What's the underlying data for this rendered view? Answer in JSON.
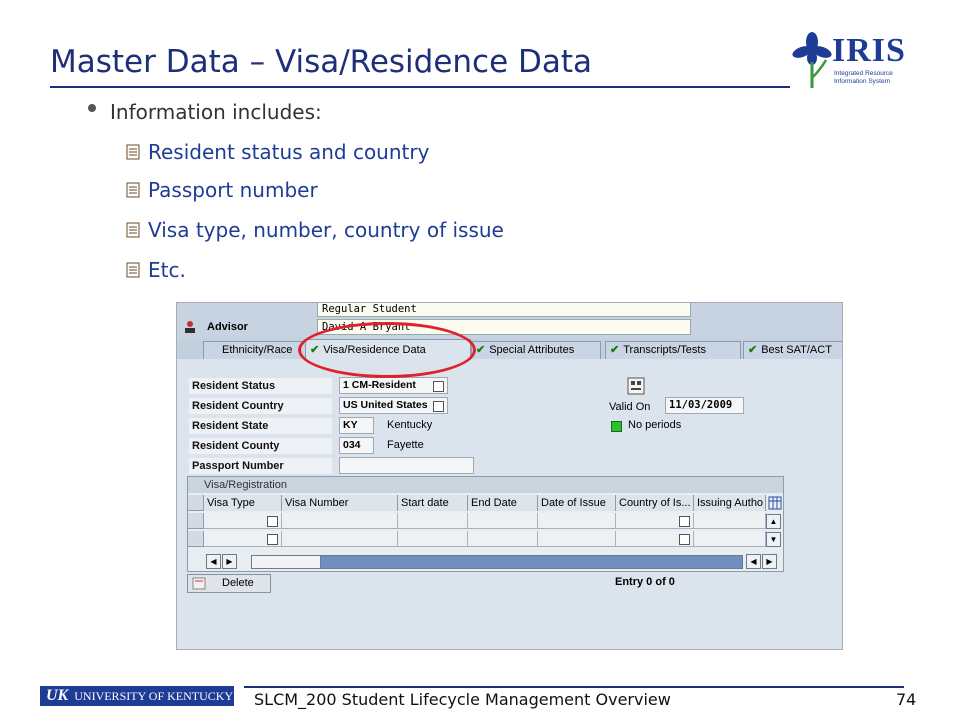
{
  "slide": {
    "title": "Master Data – Visa/Residence Data",
    "bullet": "Information includes:",
    "sub_bullets": [
      "Resident status and country",
      "Passport number",
      "Visa type, number, country of issue",
      "Etc."
    ]
  },
  "logo": {
    "name": "IRIS",
    "tagline_1": "Integrated Resource",
    "tagline_2": "Information System"
  },
  "sap": {
    "header": {
      "student_type": "Regular Student",
      "advisor_label": "Advisor",
      "advisor_value": "David A Bryant"
    },
    "tabs": [
      "Ethnicity/Race",
      "Visa/Residence Data",
      "Special Attributes",
      "Transcripts/Tests",
      "Best SAT/ACT"
    ],
    "fields": {
      "resident_status_label": "Resident Status",
      "resident_status_value": "1 CM-Resident",
      "resident_country_label": "Resident Country",
      "resident_country_value": "US United States",
      "resident_state_label": "Resident State",
      "resident_state_value": "KY",
      "resident_state_text": "Kentucky",
      "resident_county_label": "Resident County",
      "resident_county_value": "034",
      "resident_county_text": "Fayette",
      "passport_label": "Passport Number",
      "valid_on_label": "Valid On",
      "valid_on_value": "11/03/2009",
      "no_periods": "No periods"
    },
    "table": {
      "title": "Visa/Registration",
      "columns": [
        "Visa Type",
        "Visa Number",
        "Start date",
        "End Date",
        "Date of Issue",
        "Country of Is...",
        "Issuing Autho"
      ]
    },
    "delete_label": "Delete",
    "entry_text": "Entry 0 of 0"
  },
  "footer": {
    "uk_logo_text": "UNIVERSITY OF KENTUCKY",
    "course": "SLCM_200 Student Lifecycle Management Overview",
    "page": "74"
  },
  "colors": {
    "title": "#1e2f7a",
    "sub_bullet": "#1e3c96",
    "highlight_circle": "#e0202a"
  }
}
